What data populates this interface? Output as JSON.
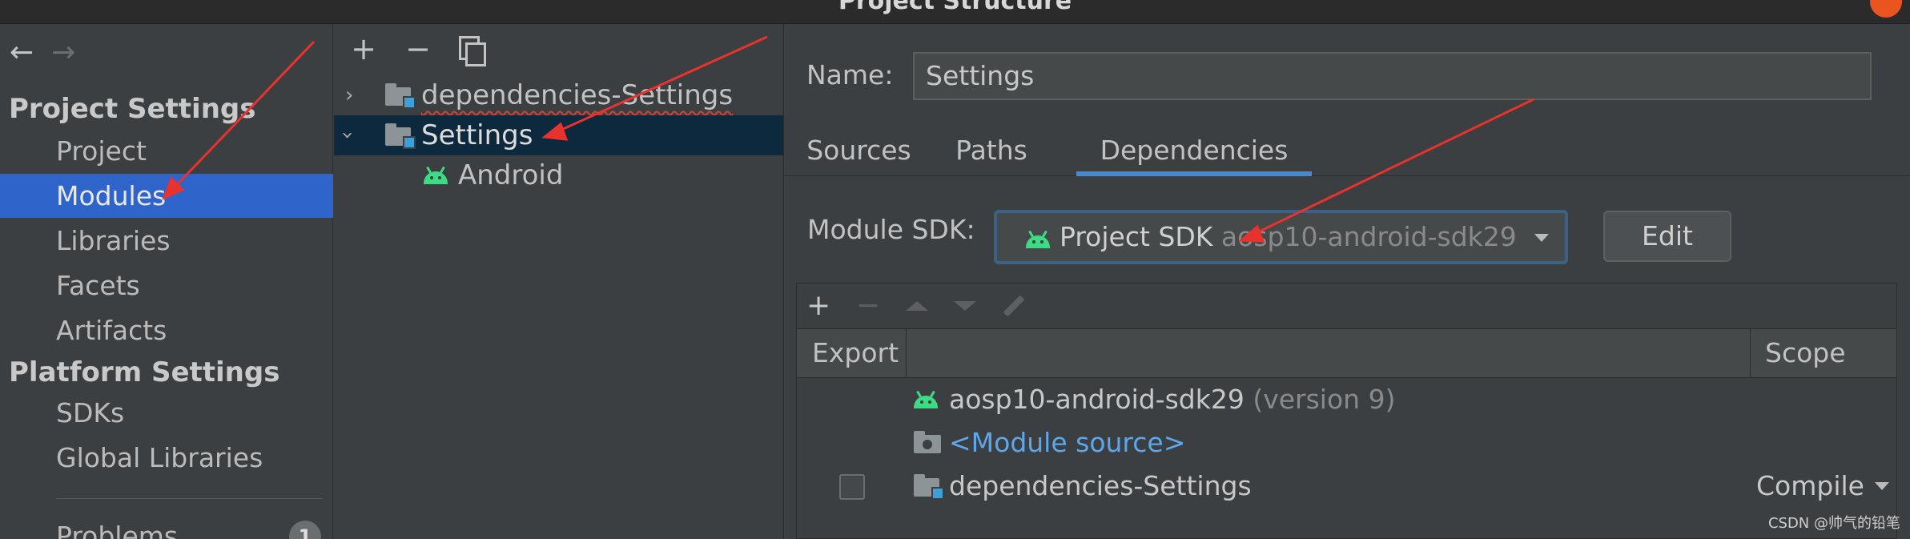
{
  "window": {
    "title": "Project Structure"
  },
  "nav": {
    "back_icon": "arrow-left-icon",
    "forward_icon": "arrow-right-icon",
    "project_settings_header": "Project Settings",
    "project_items": [
      "Project",
      "Modules",
      "Libraries",
      "Facets",
      "Artifacts"
    ],
    "platform_settings_header": "Platform Settings",
    "platform_items": [
      "SDKs",
      "Global Libraries"
    ],
    "problems_label": "Problems",
    "problems_count": "1",
    "selected": "Modules"
  },
  "tree": {
    "toolbar": {
      "add": "+",
      "remove": "−",
      "copy_icon": "copy-icon"
    },
    "rows": [
      {
        "label": "dependencies-Settings",
        "expanded": false
      },
      {
        "label": "Settings",
        "expanded": true,
        "selected": true
      },
      {
        "label": "Android"
      }
    ]
  },
  "module": {
    "name_label": "Name:",
    "name_value": "Settings",
    "tabs": [
      "Sources",
      "Paths",
      "Dependencies"
    ],
    "active_tab": "Dependencies",
    "sdk_label": "Module SDK:",
    "sdk_value": "Project SDK",
    "sdk_detail": "aosp10-android-sdk29",
    "edit_label": "Edit"
  },
  "dependencies": {
    "toolbar": {
      "add": "+",
      "remove": "−"
    },
    "col_export": "Export",
    "col_scope": "Scope",
    "rows": [
      {
        "name": "aosp10-android-sdk29",
        "detail": "(version 9)",
        "icon": "android-icon"
      },
      {
        "name": "<Module source>",
        "icon": "source-folder-icon"
      },
      {
        "name": "dependencies-Settings",
        "icon": "module-folder-icon",
        "export": false,
        "scope": "Compile"
      }
    ]
  },
  "watermark": "CSDN @帅气的铅笔",
  "colors": {
    "selected_nav": "#2f65ca",
    "selected_tree": "#0d293e",
    "tab_underline": "#4a88c7",
    "android_green": "#3ddc84",
    "module_source_blue": "#5ea6ea",
    "annotation_red": "#e8322d"
  }
}
